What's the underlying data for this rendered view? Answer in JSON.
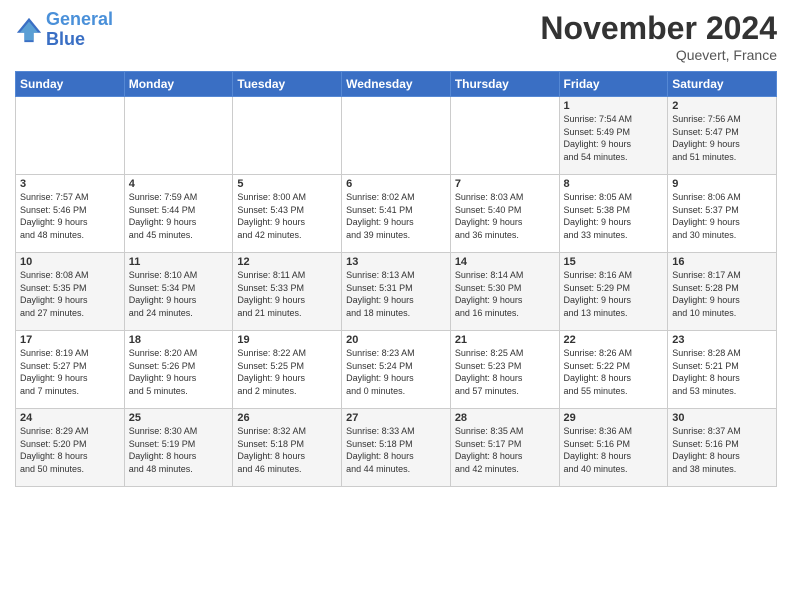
{
  "header": {
    "logo_line1": "General",
    "logo_line2": "Blue",
    "month": "November 2024",
    "location": "Quevert, France"
  },
  "days_of_week": [
    "Sunday",
    "Monday",
    "Tuesday",
    "Wednesday",
    "Thursday",
    "Friday",
    "Saturday"
  ],
  "weeks": [
    [
      {
        "day": "",
        "info": ""
      },
      {
        "day": "",
        "info": ""
      },
      {
        "day": "",
        "info": ""
      },
      {
        "day": "",
        "info": ""
      },
      {
        "day": "",
        "info": ""
      },
      {
        "day": "1",
        "info": "Sunrise: 7:54 AM\nSunset: 5:49 PM\nDaylight: 9 hours\nand 54 minutes."
      },
      {
        "day": "2",
        "info": "Sunrise: 7:56 AM\nSunset: 5:47 PM\nDaylight: 9 hours\nand 51 minutes."
      }
    ],
    [
      {
        "day": "3",
        "info": "Sunrise: 7:57 AM\nSunset: 5:46 PM\nDaylight: 9 hours\nand 48 minutes."
      },
      {
        "day": "4",
        "info": "Sunrise: 7:59 AM\nSunset: 5:44 PM\nDaylight: 9 hours\nand 45 minutes."
      },
      {
        "day": "5",
        "info": "Sunrise: 8:00 AM\nSunset: 5:43 PM\nDaylight: 9 hours\nand 42 minutes."
      },
      {
        "day": "6",
        "info": "Sunrise: 8:02 AM\nSunset: 5:41 PM\nDaylight: 9 hours\nand 39 minutes."
      },
      {
        "day": "7",
        "info": "Sunrise: 8:03 AM\nSunset: 5:40 PM\nDaylight: 9 hours\nand 36 minutes."
      },
      {
        "day": "8",
        "info": "Sunrise: 8:05 AM\nSunset: 5:38 PM\nDaylight: 9 hours\nand 33 minutes."
      },
      {
        "day": "9",
        "info": "Sunrise: 8:06 AM\nSunset: 5:37 PM\nDaylight: 9 hours\nand 30 minutes."
      }
    ],
    [
      {
        "day": "10",
        "info": "Sunrise: 8:08 AM\nSunset: 5:35 PM\nDaylight: 9 hours\nand 27 minutes."
      },
      {
        "day": "11",
        "info": "Sunrise: 8:10 AM\nSunset: 5:34 PM\nDaylight: 9 hours\nand 24 minutes."
      },
      {
        "day": "12",
        "info": "Sunrise: 8:11 AM\nSunset: 5:33 PM\nDaylight: 9 hours\nand 21 minutes."
      },
      {
        "day": "13",
        "info": "Sunrise: 8:13 AM\nSunset: 5:31 PM\nDaylight: 9 hours\nand 18 minutes."
      },
      {
        "day": "14",
        "info": "Sunrise: 8:14 AM\nSunset: 5:30 PM\nDaylight: 9 hours\nand 16 minutes."
      },
      {
        "day": "15",
        "info": "Sunrise: 8:16 AM\nSunset: 5:29 PM\nDaylight: 9 hours\nand 13 minutes."
      },
      {
        "day": "16",
        "info": "Sunrise: 8:17 AM\nSunset: 5:28 PM\nDaylight: 9 hours\nand 10 minutes."
      }
    ],
    [
      {
        "day": "17",
        "info": "Sunrise: 8:19 AM\nSunset: 5:27 PM\nDaylight: 9 hours\nand 7 minutes."
      },
      {
        "day": "18",
        "info": "Sunrise: 8:20 AM\nSunset: 5:26 PM\nDaylight: 9 hours\nand 5 minutes."
      },
      {
        "day": "19",
        "info": "Sunrise: 8:22 AM\nSunset: 5:25 PM\nDaylight: 9 hours\nand 2 minutes."
      },
      {
        "day": "20",
        "info": "Sunrise: 8:23 AM\nSunset: 5:24 PM\nDaylight: 9 hours\nand 0 minutes."
      },
      {
        "day": "21",
        "info": "Sunrise: 8:25 AM\nSunset: 5:23 PM\nDaylight: 8 hours\nand 57 minutes."
      },
      {
        "day": "22",
        "info": "Sunrise: 8:26 AM\nSunset: 5:22 PM\nDaylight: 8 hours\nand 55 minutes."
      },
      {
        "day": "23",
        "info": "Sunrise: 8:28 AM\nSunset: 5:21 PM\nDaylight: 8 hours\nand 53 minutes."
      }
    ],
    [
      {
        "day": "24",
        "info": "Sunrise: 8:29 AM\nSunset: 5:20 PM\nDaylight: 8 hours\nand 50 minutes."
      },
      {
        "day": "25",
        "info": "Sunrise: 8:30 AM\nSunset: 5:19 PM\nDaylight: 8 hours\nand 48 minutes."
      },
      {
        "day": "26",
        "info": "Sunrise: 8:32 AM\nSunset: 5:18 PM\nDaylight: 8 hours\nand 46 minutes."
      },
      {
        "day": "27",
        "info": "Sunrise: 8:33 AM\nSunset: 5:18 PM\nDaylight: 8 hours\nand 44 minutes."
      },
      {
        "day": "28",
        "info": "Sunrise: 8:35 AM\nSunset: 5:17 PM\nDaylight: 8 hours\nand 42 minutes."
      },
      {
        "day": "29",
        "info": "Sunrise: 8:36 AM\nSunset: 5:16 PM\nDaylight: 8 hours\nand 40 minutes."
      },
      {
        "day": "30",
        "info": "Sunrise: 8:37 AM\nSunset: 5:16 PM\nDaylight: 8 hours\nand 38 minutes."
      }
    ]
  ]
}
